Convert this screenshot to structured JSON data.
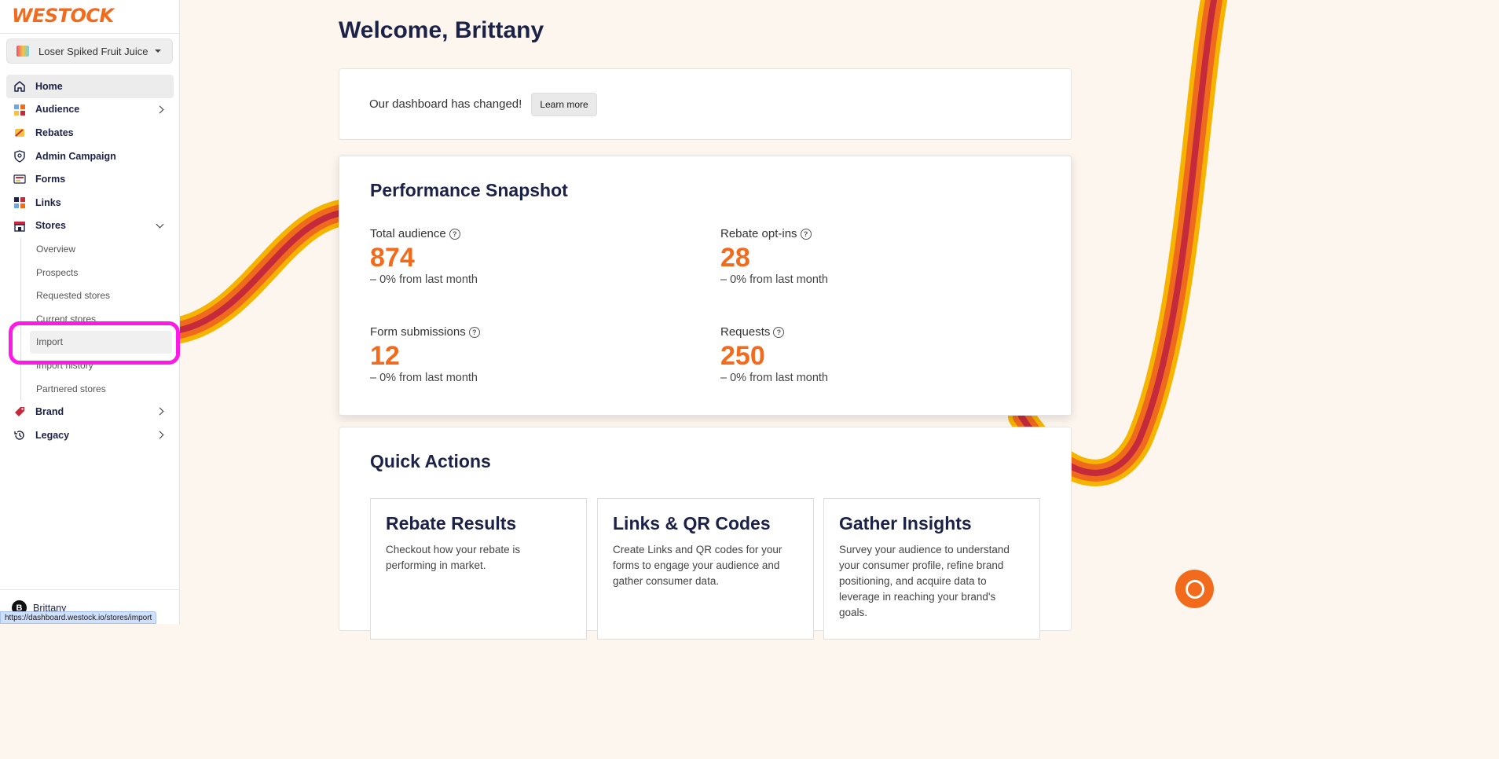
{
  "app": {
    "logo": "WESTOCK"
  },
  "brand_selector": {
    "value": "Loser Spiked Fruit Juice"
  },
  "sidebar": {
    "items": [
      {
        "label": "Home",
        "icon": "home-icon"
      },
      {
        "label": "Audience",
        "icon": "audience-icon"
      },
      {
        "label": "Rebates",
        "icon": "rebates-icon"
      },
      {
        "label": "Admin Campaign",
        "icon": "shield-icon"
      },
      {
        "label": "Forms",
        "icon": "forms-icon"
      },
      {
        "label": "Links",
        "icon": "links-icon"
      },
      {
        "label": "Stores",
        "icon": "store-icon"
      }
    ],
    "stores_sub": [
      "Overview",
      "Prospects",
      "Requested stores",
      "Current stores",
      "Import",
      "Import history",
      "Partnered stores"
    ],
    "bottom_items": [
      {
        "label": "Brand",
        "icon": "brand-tag-icon"
      },
      {
        "label": "Legacy",
        "icon": "history-icon"
      }
    ]
  },
  "user": {
    "name": "Brittany",
    "initial": "B"
  },
  "status_url": "https://dashboard.westock.io/stores/import",
  "main": {
    "title": "Welcome, Brittany",
    "notice": {
      "text": "Our dashboard has changed!",
      "button": "Learn more"
    },
    "snapshot": {
      "title": "Performance Snapshot",
      "metrics": [
        {
          "label": "Total audience",
          "value": "874",
          "change": "– 0% from last month"
        },
        {
          "label": "Rebate opt-ins",
          "value": "28",
          "change": "– 0% from last month"
        },
        {
          "label": "Form submissions",
          "value": "12",
          "change": "– 0% from last month"
        },
        {
          "label": "Requests",
          "value": "250",
          "change": "– 0% from last month"
        }
      ]
    },
    "quick_actions": {
      "title": "Quick Actions",
      "cards": [
        {
          "title": "Rebate Results",
          "desc": "Checkout how your rebate is performing in market."
        },
        {
          "title": "Links & QR Codes",
          "desc": "Create Links and QR codes for your forms to engage your audience and gather consumer data."
        },
        {
          "title": "Gather Insights",
          "desc": "Survey your audience to understand your consumer profile, refine brand positioning, and acquire data to leverage in reaching your brand's goals."
        }
      ]
    }
  },
  "colors": {
    "accent": "#f26a1b",
    "navy": "#1c2147",
    "highlight": "#ff19e6"
  }
}
